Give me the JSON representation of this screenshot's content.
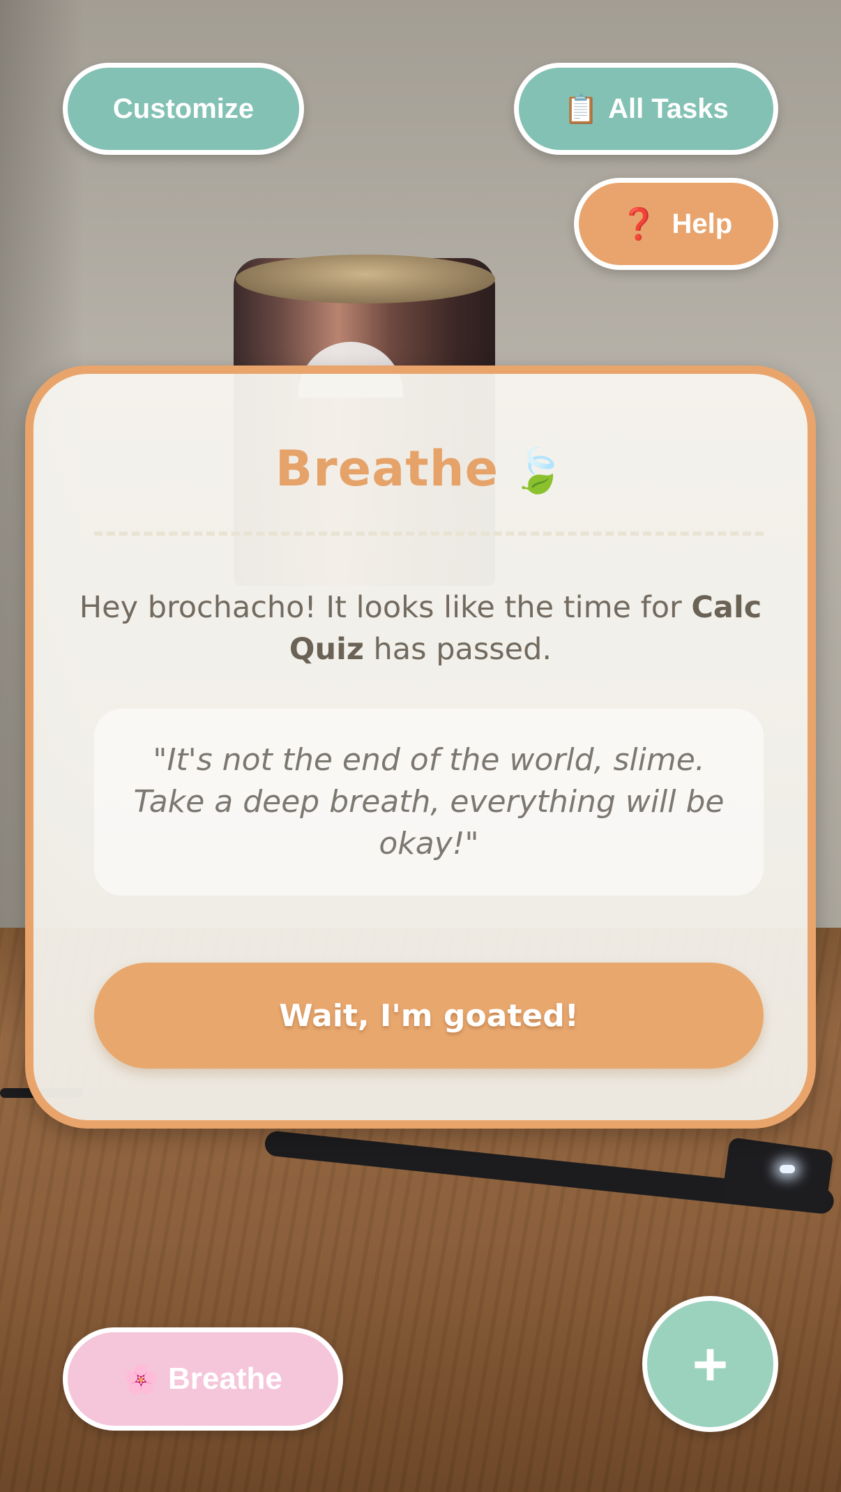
{
  "header": {
    "customize_label": "Customize",
    "all_tasks_icon": "📋",
    "all_tasks_label": "All Tasks",
    "help_icon": "❓",
    "help_label": "Help"
  },
  "dialog": {
    "title": "Breathe",
    "title_icon": "🍃",
    "message_prefix": "Hey brochacho! It looks like the time for ",
    "task_name": "Calc Quiz",
    "message_suffix": " has passed.",
    "quote": "\"It's not the end of the world, slime. Take a deep breath, everything will be okay!\"",
    "confirm_label": "Wait, I'm goated!"
  },
  "footer": {
    "breathe_icon": "🌸",
    "breathe_label": "Breathe",
    "add_label": "+"
  },
  "colors": {
    "teal": "#82c1b3",
    "orange": "#e8a46c",
    "pink": "#f5c5d9",
    "mint": "#9bd2be"
  }
}
